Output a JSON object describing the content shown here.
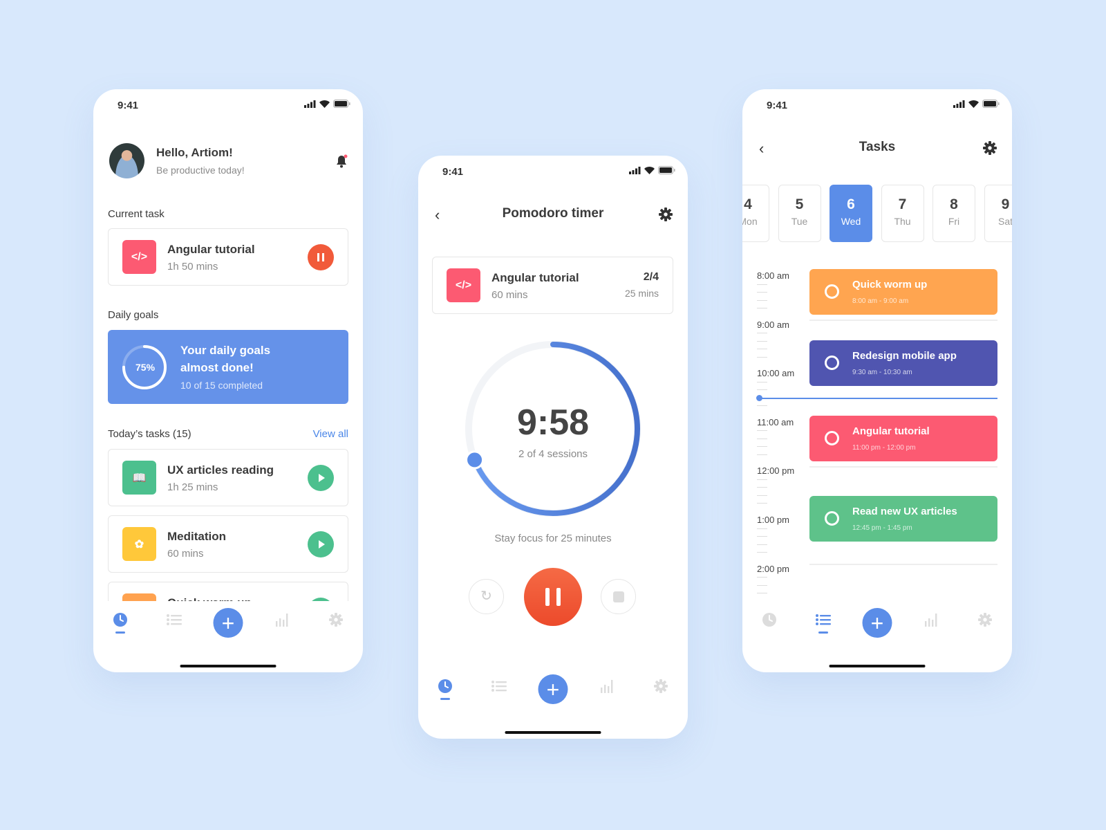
{
  "colors": {
    "background": "#d8e8fc",
    "accent": "#5b8de8",
    "red": "#fc5a72",
    "orange": "#f15a3a",
    "green": "#4cc08e",
    "yellow": "#ffc83a",
    "purple": "#5055b0"
  },
  "status": {
    "time": "9:41"
  },
  "nav": {
    "items": [
      "clock-icon",
      "list-icon",
      "plus-icon",
      "chart-icon",
      "gear-icon"
    ],
    "plus": "+"
  },
  "home": {
    "greeting": "Hello, Artiom!",
    "subtitle": "Be productive today!",
    "current_task_label": "Current task",
    "current_task": {
      "title": "Angular tutorial",
      "duration": "1h 50 mins",
      "icon": "</>"
    },
    "daily_goals_label": "Daily goals",
    "goals": {
      "percent_label": "75%",
      "progress": 0.75,
      "line1": "Your daily goals",
      "line2": "almost done!",
      "completed": "10 of 15 completed"
    },
    "todays_tasks_label": "Today’s tasks (15)",
    "view_all": "View all",
    "tasks": [
      {
        "title": "UX articles reading",
        "duration": "1h 25 mins",
        "color": "#4cc08e",
        "icon": "book-icon"
      },
      {
        "title": "Meditation",
        "duration": "60 mins",
        "color": "#ffc83a",
        "icon": "lotus-icon"
      },
      {
        "title": "Quick warm up",
        "duration": "",
        "color": "#ffa24f",
        "icon": "run-icon"
      }
    ]
  },
  "timer": {
    "title": "Pomodoro timer",
    "task": {
      "title": "Angular tutorial",
      "duration": "60 mins",
      "sessions": "2/4",
      "session_length": "25 mins",
      "icon": "</>"
    },
    "time": "9:58",
    "sessions_text": "2 of 4 sessions",
    "progress": 0.69,
    "hint": "Stay focus for 25 minutes"
  },
  "tasks_screen": {
    "title": "Tasks",
    "days": [
      {
        "num": "4",
        "name": "Mon",
        "active": false
      },
      {
        "num": "5",
        "name": "Tue",
        "active": false
      },
      {
        "num": "6",
        "name": "Wed",
        "active": true
      },
      {
        "num": "7",
        "name": "Thu",
        "active": false
      },
      {
        "num": "8",
        "name": "Fri",
        "active": false
      },
      {
        "num": "9",
        "name": "Sat",
        "active": false
      }
    ],
    "times": [
      "8:00 am",
      "9:00 am",
      "10:00 am",
      "11:00 am",
      "12:00 pm",
      "1:00 pm",
      "2:00 pm"
    ],
    "events": [
      {
        "title": "Quick worm up",
        "time": "8:00 am - 9:00 am",
        "color": "#ffa550"
      },
      {
        "title": "Redesign mobile app",
        "time": "9:30 am - 10:30 am",
        "color": "#5055b0"
      },
      {
        "title": "Angular tutorial",
        "time": "11:00 pm - 12:00 pm",
        "color": "#fc5a72"
      },
      {
        "title": "Read new UX articles",
        "time": "12:45 pm - 1:45 pm",
        "color": "#5ec28a"
      }
    ]
  }
}
